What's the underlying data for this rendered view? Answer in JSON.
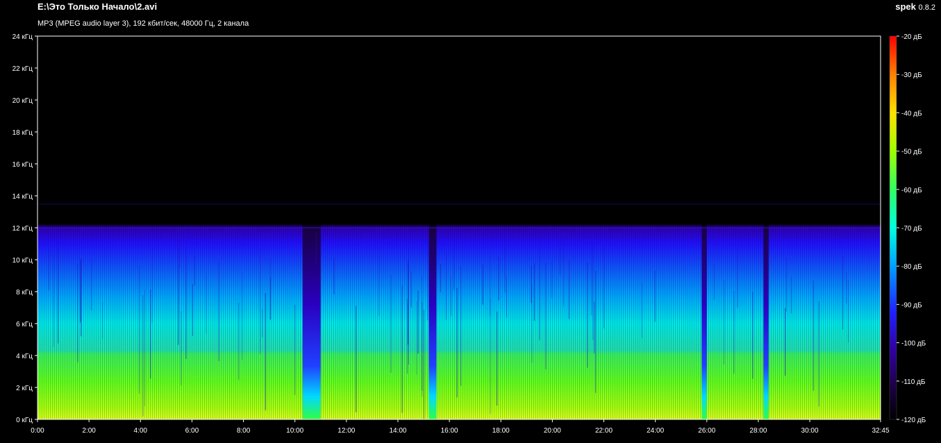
{
  "window": {
    "file_title": "E:\\Это Только Начало\\2.avi",
    "stream_info": "MP3 (MPEG audio layer 3), 192 кбит/сек, 48000 Гц, 2 канала",
    "app_name": "spek",
    "app_version": "0.8.2"
  },
  "colors": {
    "background": "#000000",
    "axis": "#ffffff",
    "palette": [
      "#000000",
      "#1a0040",
      "#3000a0",
      "#2020ff",
      "#00a0ff",
      "#00ffe0",
      "#30ff60",
      "#a0ff00",
      "#ffe000",
      "#ff8000",
      "#ff0000"
    ]
  },
  "chart_data": {
    "type": "heatmap",
    "title": "",
    "x_axis": {
      "unit": "time",
      "range": [
        "0:00",
        "32:45"
      ],
      "range_minutes": [
        0,
        32.75
      ],
      "ticks": [
        "0:00",
        "2:00",
        "4:00",
        "6:00",
        "8:00",
        "10:00",
        "12:00",
        "14:00",
        "16:00",
        "18:00",
        "20:00",
        "22:00",
        "24:00",
        "26:00",
        "28:00",
        "30:00",
        "32:45"
      ]
    },
    "y_axis": {
      "unit": "kHz",
      "range": [
        0,
        24
      ],
      "ticks": [
        "0 кГц",
        "2 кГц",
        "4 кГц",
        "6 кГц",
        "8 кГц",
        "10 кГц",
        "12 кГц",
        "14 кГц",
        "16 кГц",
        "18 кГц",
        "20 кГц",
        "22 кГц",
        "24 кГц"
      ]
    },
    "colorbar": {
      "unit": "dB",
      "range": [
        -120,
        -20
      ],
      "ticks": [
        "-20 дБ",
        "-30 дБ",
        "-40 дБ",
        "-50 дБ",
        "-60 дБ",
        "-70 дБ",
        "-80 дБ",
        "-90 дБ",
        "-100 дБ",
        "-110 дБ",
        "-120 дБ"
      ]
    },
    "approx_cutoff_khz": 12,
    "quiet_segments_minutes": [
      [
        10.3,
        11.0
      ],
      [
        15.2,
        15.5
      ],
      [
        25.8,
        26.0
      ],
      [
        28.2,
        28.4
      ]
    ]
  }
}
